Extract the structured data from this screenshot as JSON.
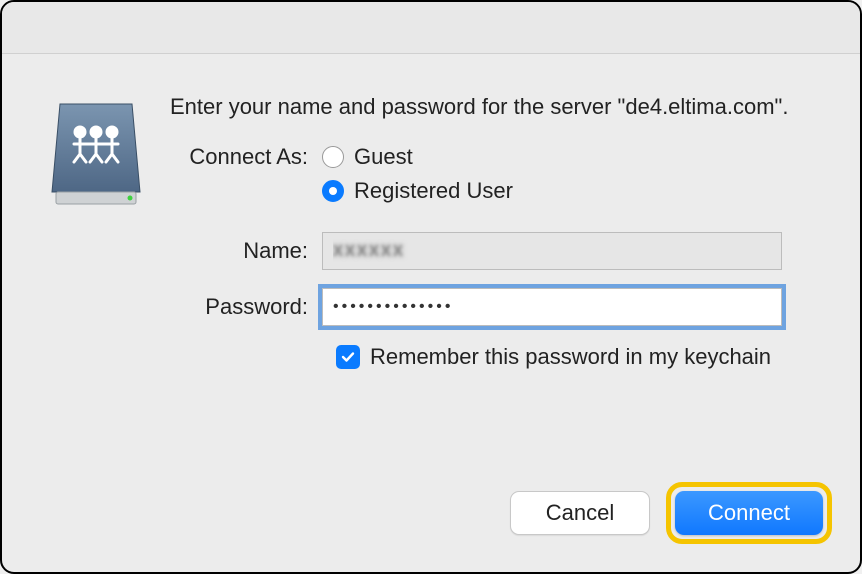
{
  "heading": "Enter your name and password for the server \"de4.eltima.com\".",
  "connect_as_label": "Connect As:",
  "radios": {
    "guest": "Guest",
    "registered": "Registered User"
  },
  "selected_radio": "registered",
  "fields": {
    "name_label": "Name:",
    "name_value": "xxxxxx",
    "password_label": "Password:",
    "password_value": "••••••••••••••"
  },
  "remember": {
    "checked": true,
    "label": "Remember this password in my keychain"
  },
  "buttons": {
    "cancel": "Cancel",
    "connect": "Connect"
  }
}
